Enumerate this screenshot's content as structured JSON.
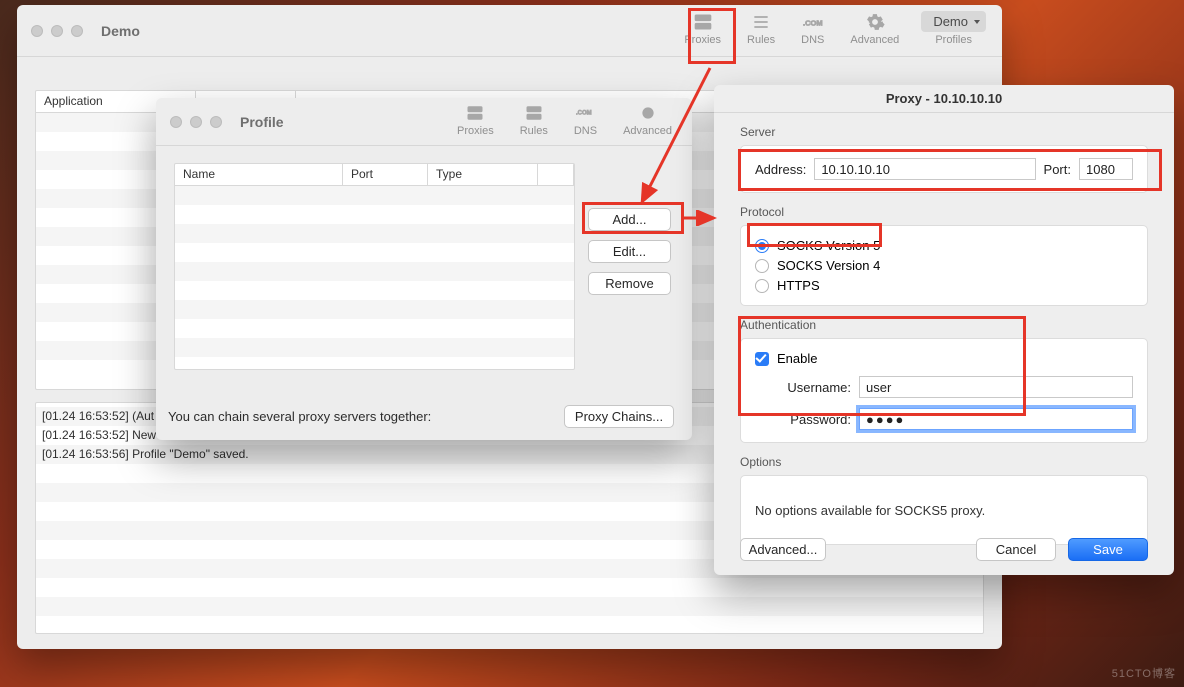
{
  "bg_watermark": "51CTO博客",
  "main_window": {
    "title": "Demo",
    "toolbar": {
      "proxies": "Proxies",
      "rules": "Rules",
      "dns": "DNS",
      "advanced": "Advanced",
      "profiles_label": "Profiles",
      "profiles_value": "Demo"
    },
    "application_header": "Application",
    "log": [
      "[01.24 16:53:52] (Aut",
      "[01.24 16:53:52] New",
      "[01.24 16:53:56] Profile \"Demo\" saved."
    ]
  },
  "profile_window": {
    "title": "Profile",
    "toolbar": {
      "proxies": "Proxies",
      "rules": "Rules",
      "dns": "DNS",
      "advanced": "Advanced"
    },
    "columns": {
      "name": "Name",
      "port": "Port",
      "type": "Type"
    },
    "buttons": {
      "add": "Add...",
      "edit": "Edit...",
      "remove": "Remove",
      "chains": "Proxy Chains..."
    },
    "chain_hint": "You can chain several proxy servers together:"
  },
  "proxy_dialog": {
    "title": "Proxy - 10.10.10.10",
    "server": {
      "label": "Server",
      "address_label": "Address:",
      "address_value": "10.10.10.10",
      "port_label": "Port:",
      "port_value": "1080"
    },
    "protocol": {
      "label": "Protocol",
      "opt_socks5": "SOCKS Version 5",
      "opt_socks4": "SOCKS Version 4",
      "opt_https": "HTTPS"
    },
    "auth": {
      "label": "Authentication",
      "enable": "Enable",
      "username_label": "Username:",
      "username_value": "user",
      "password_label": "Password:",
      "password_value": "●●●●"
    },
    "options": {
      "label": "Options",
      "none_msg": "No options available for SOCKS5 proxy."
    },
    "buttons": {
      "advanced": "Advanced...",
      "cancel": "Cancel",
      "save": "Save"
    }
  }
}
